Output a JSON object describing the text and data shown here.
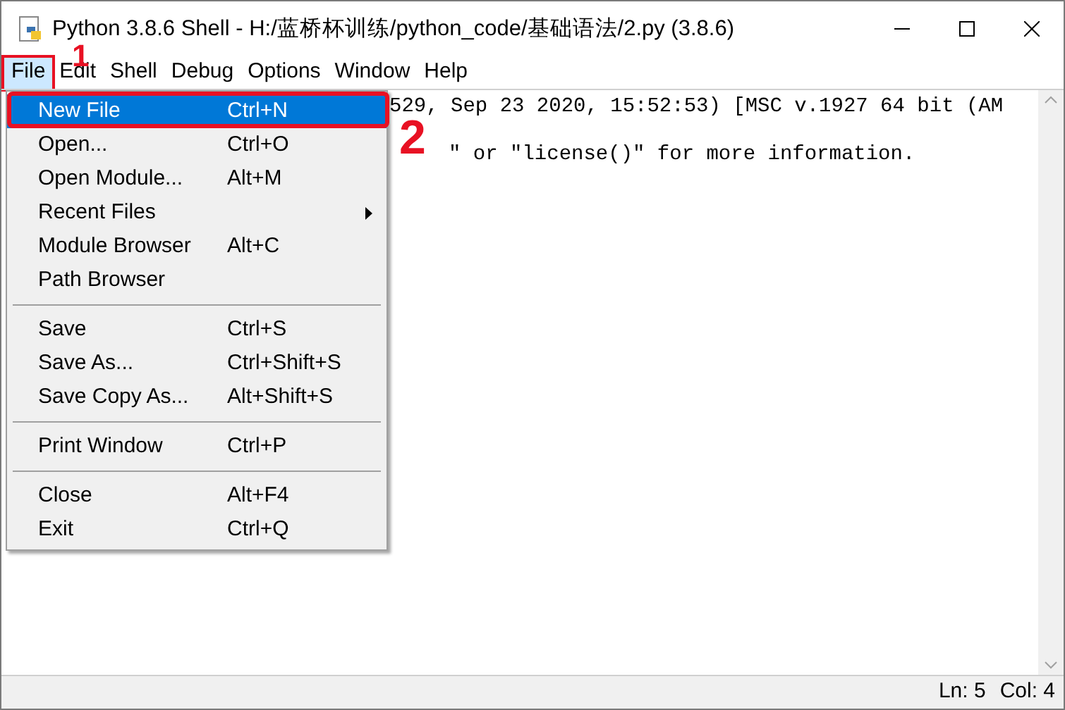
{
  "window": {
    "title": "Python 3.8.6 Shell - H:/蓝桥杯训练/python_code/基础语法/2.py (3.8.6)"
  },
  "menu_bar": [
    {
      "label": "File",
      "selected": true
    },
    {
      "label": "Edit",
      "selected": false
    },
    {
      "label": "Shell",
      "selected": false
    },
    {
      "label": "Debug",
      "selected": false
    },
    {
      "label": "Options",
      "selected": false
    },
    {
      "label": "Window",
      "selected": false
    },
    {
      "label": "Help",
      "selected": false
    }
  ],
  "file_menu": [
    {
      "kind": "item",
      "label": "New File",
      "shortcut": "Ctrl+N",
      "selected": true
    },
    {
      "kind": "item",
      "label": "Open...",
      "shortcut": "Ctrl+O",
      "selected": false
    },
    {
      "kind": "item",
      "label": "Open Module...",
      "shortcut": "Alt+M",
      "selected": false
    },
    {
      "kind": "submenu",
      "label": "Recent Files",
      "selected": false
    },
    {
      "kind": "item",
      "label": "Module Browser",
      "shortcut": "Alt+C",
      "selected": false
    },
    {
      "kind": "item",
      "label": "Path Browser",
      "selected": false
    },
    {
      "kind": "separator"
    },
    {
      "kind": "item",
      "label": "Save",
      "shortcut": "Ctrl+S",
      "selected": false
    },
    {
      "kind": "item",
      "label": "Save As...",
      "shortcut": "Ctrl+Shift+S",
      "selected": false
    },
    {
      "kind": "item",
      "label": "Save Copy As...",
      "shortcut": "Alt+Shift+S",
      "selected": false
    },
    {
      "kind": "separator"
    },
    {
      "kind": "item",
      "label": "Print Window",
      "shortcut": "Ctrl+P",
      "selected": false
    },
    {
      "kind": "separator"
    },
    {
      "kind": "item",
      "label": "Close",
      "shortcut": "Alt+F4",
      "selected": false
    },
    {
      "kind": "item",
      "label": "Exit",
      "shortcut": "Ctrl+Q",
      "selected": false
    }
  ],
  "editor": {
    "lines": [
      "529, Sep 23 2020, 15:52:53) [MSC v.1927 64 bit (AM",
      "\" or \"license()\" for more information."
    ]
  },
  "annotations": [
    "1",
    "2"
  ],
  "status_bar": {
    "line": "Ln: 5",
    "column": "Col: 4"
  }
}
